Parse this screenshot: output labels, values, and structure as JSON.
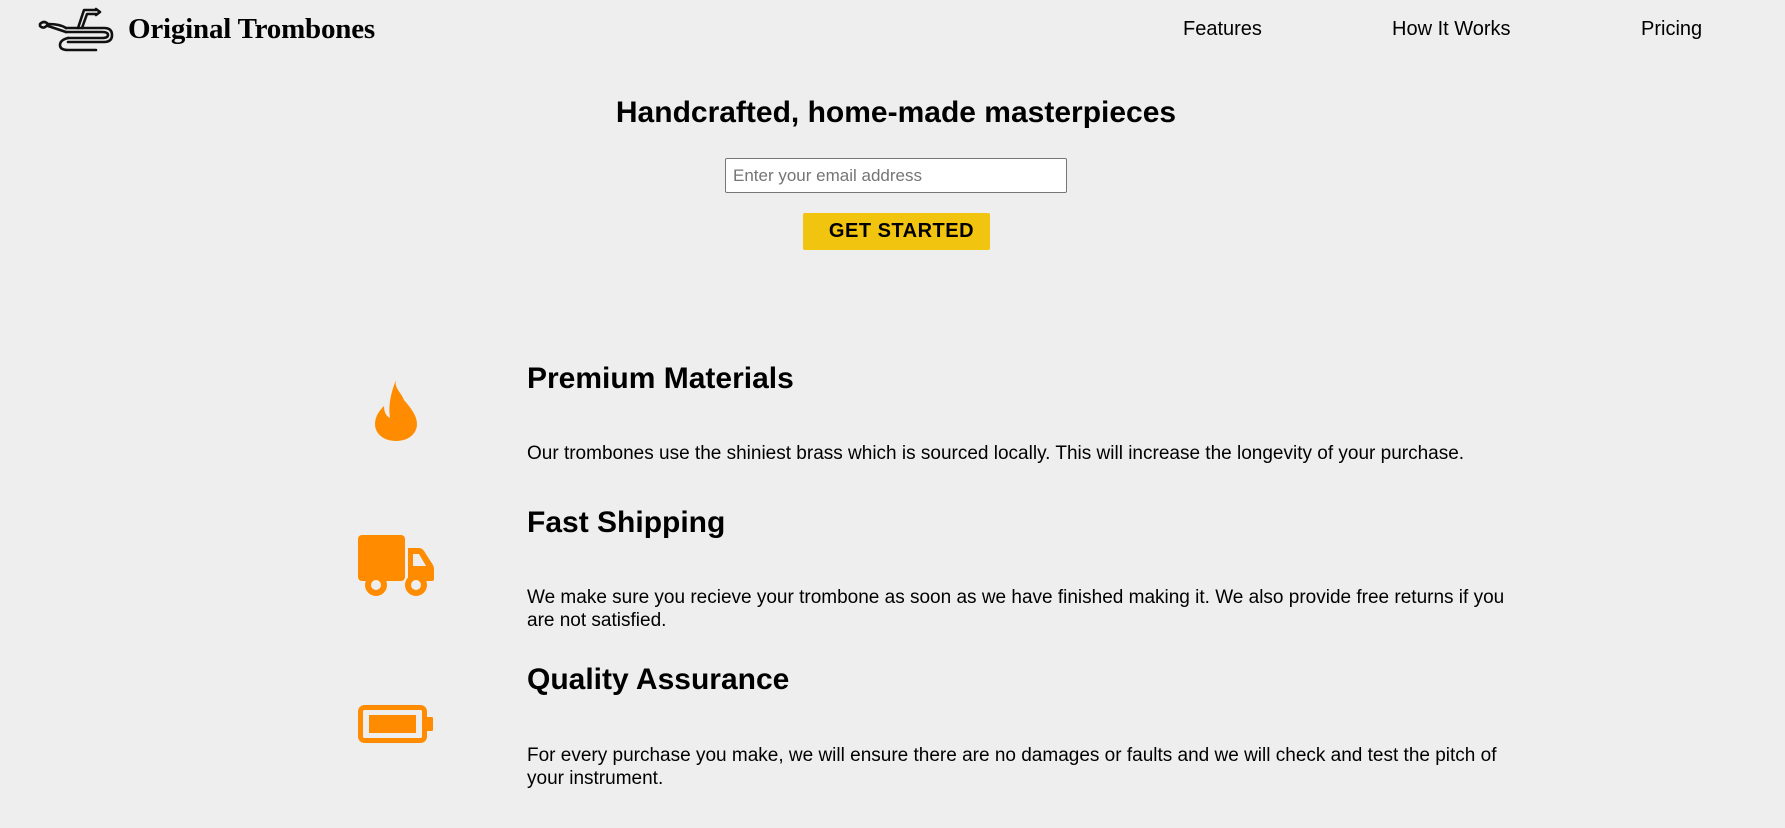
{
  "header": {
    "brand": "Original Trombones",
    "logo_icon": "trombone-icon",
    "nav": [
      {
        "label": "Features"
      },
      {
        "label": "How It Works"
      },
      {
        "label": "Pricing"
      }
    ]
  },
  "hero": {
    "title": "Handcrafted, home-made masterpieces",
    "email_placeholder": "Enter your email address",
    "email_value": "",
    "cta_label": "GET STARTED"
  },
  "colors": {
    "background": "#eeeeee",
    "accent_orange": "#ff8c00",
    "cta_yellow": "#f1c40f"
  },
  "features": [
    {
      "icon": "fire-icon",
      "title": "Premium Materials",
      "description": "Our trombones use the shiniest brass which is sourced locally. This will increase the longevity of your purchase."
    },
    {
      "icon": "truck-icon",
      "title": "Fast Shipping",
      "description": "We make sure you recieve your trombone as soon as we have finished making it. We also provide free returns if you are not satisfied."
    },
    {
      "icon": "battery-icon",
      "title": "Quality Assurance",
      "description": "For every purchase you make, we will ensure there are no damages or faults and we will check and test the pitch of your instrument."
    }
  ]
}
